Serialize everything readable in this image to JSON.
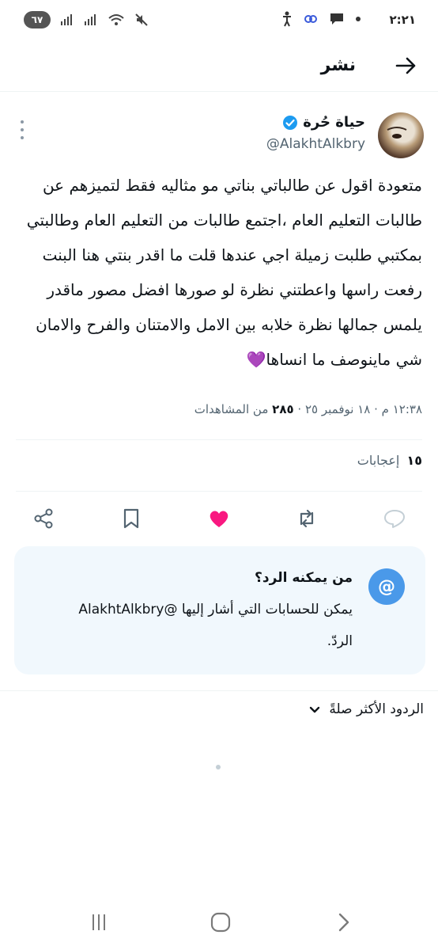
{
  "status_bar": {
    "time": "٢:٢١",
    "battery": "٦٧",
    "network": "5"
  },
  "header": {
    "title": "نشر"
  },
  "tweet": {
    "display_name": "حياة حُرة",
    "handle": "@AlakhtAlkbry",
    "text": "متعودة اقول عن طالباتي بناتي مو مثاليه  فقط لتميزهم عن طالبات التعليم العام ،اجتمع طالبات من التعليم العام وطالبتي بمكتبي طلبت زميلة اجي عندها قلت ما اقدر بنتي هنا البنت رفعت راسها واعطتني نظرة لو صورها افضل مصور ماقدر يلمس جمالها نظرة خلابه بين الامل والامتنان والفرح والامان شي ماينوصف ما انساها💜",
    "time": "١٢:٣٨ م",
    "date": "١٨ نوفمبر ٢٥",
    "views_count": "٢٨٥",
    "views_label": "من المشاهدات",
    "likes_count": "١٥",
    "likes_label": "إعجابات"
  },
  "reply_card": {
    "icon": "@",
    "title": "من يمكنه الرد؟",
    "body": "يمكن للحسابات التي أشار إليها @AlakhtAlkbry الردّ."
  },
  "replies": {
    "sort_label": "الردود الأكثر صلةً"
  },
  "colors": {
    "verified": "#1d9bf0",
    "like_active": "#f91880",
    "reply_card_bg": "#f1f8fd",
    "at_circle": "#4a99e9",
    "muted_text": "#536471"
  }
}
